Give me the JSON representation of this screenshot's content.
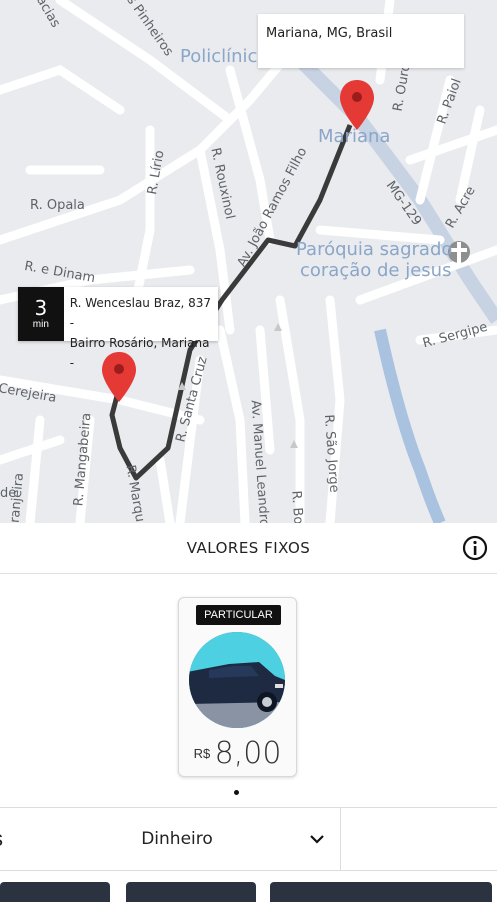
{
  "map": {
    "destination_address": "Mariana, MG, Brasil",
    "origin_address_line1": "R. Wenceslau Braz, 837 -",
    "origin_address_line2": "Bairro Rosário, Mariana -",
    "eta_value": "3",
    "eta_unit": "min",
    "labels": {
      "pinheiros": "dos Pinheiros",
      "acacias": "acacias",
      "policlinica": "Policlínica",
      "mariana": "Mariana",
      "lirio": "R. Lírio",
      "rouxinol": "R. Rouxinol",
      "opala": "R. Opala",
      "jrf": "Av. João Ramos Filho",
      "dinamarca": "R. e Dinam",
      "paroquia1": "Paróquia sagrado",
      "paroquia2": "coração de jesus",
      "mg129": "MG-129",
      "ouro": "R. Ouro",
      "paiol": "R. Paiol",
      "acre": "R. Acre",
      "sergipe": "R. Sergipe",
      "cerejeira": "Cerejeira",
      "santacruz": "R. Santa Cruz",
      "mangabeira": "R. Mangabeira",
      "laranjeira": "Laranjeira",
      "marquis": "R. Marqu",
      "manuel": "Av. Manuel Leandro",
      "saojorge": "R. São Jorge",
      "rbo": "R. Bo",
      "de": "de"
    }
  },
  "header": {
    "title": "VALORES FIXOS"
  },
  "vehicle": {
    "category": "PARTICULAR",
    "currency": "R$",
    "price": "8,00"
  },
  "payment": {
    "method": "Dinheiro",
    "left_partial": "s"
  },
  "colors": {
    "route": "#3a3a3a",
    "pin": "#e53935",
    "dark": "#111111",
    "button": "#2c3340"
  }
}
